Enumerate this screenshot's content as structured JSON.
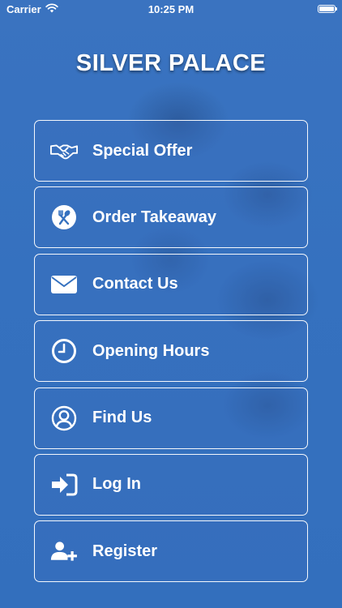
{
  "status_bar": {
    "carrier": "Carrier",
    "time": "10:25 PM",
    "icons": [
      "wifi-icon",
      "battery-icon"
    ]
  },
  "app": {
    "title": "SILVER PALACE"
  },
  "menu": {
    "items": [
      {
        "label": "Special Offer",
        "icon": "handshake-icon"
      },
      {
        "label": "Order Takeaway",
        "icon": "cutlery-icon"
      },
      {
        "label": "Contact Us",
        "icon": "envelope-icon"
      },
      {
        "label": "Opening Hours",
        "icon": "clock-icon"
      },
      {
        "label": "Find Us",
        "icon": "user-circle-icon"
      },
      {
        "label": "Log In",
        "icon": "sign-in-icon"
      },
      {
        "label": "Register",
        "icon": "user-plus-icon"
      }
    ]
  },
  "colors": {
    "background": "#3571bf",
    "text": "#ffffff",
    "border": "#ffffff"
  }
}
